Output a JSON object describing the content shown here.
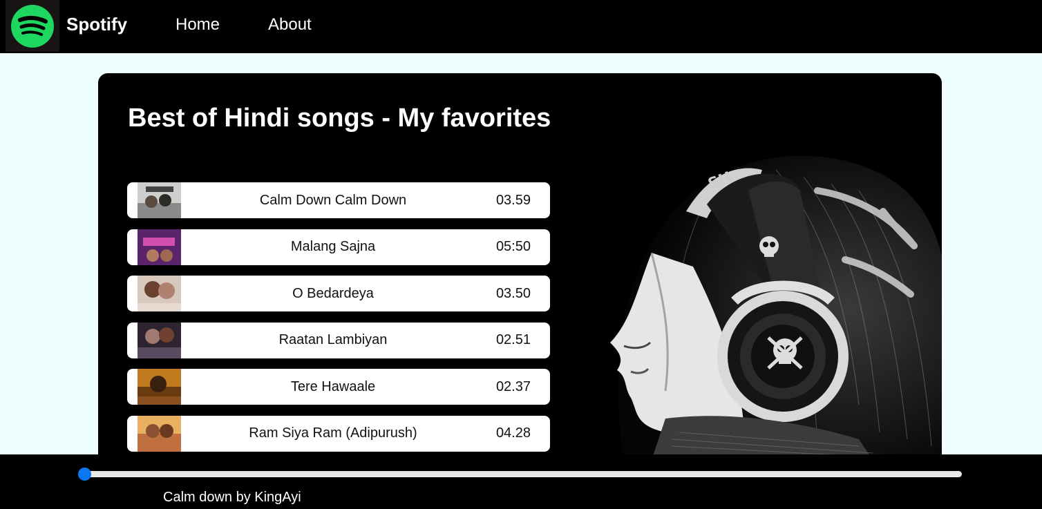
{
  "nav": {
    "brand": "Spotify",
    "links": [
      {
        "label": "Home"
      },
      {
        "label": "About"
      }
    ]
  },
  "playlist": {
    "title": "Best of Hindi songs - My favorites",
    "songs": [
      {
        "name": "Calm Down Calm Down",
        "duration": "03.59"
      },
      {
        "name": "Malang Sajna",
        "duration": "05:50"
      },
      {
        "name": "O Bedardeya",
        "duration": "03.50"
      },
      {
        "name": "Raatan Lambiyan",
        "duration": "02.51"
      },
      {
        "name": "Tere Hawaale",
        "duration": "02.37"
      },
      {
        "name": "Ram Siya Ram (Adipurush)",
        "duration": "04.28"
      }
    ]
  },
  "player": {
    "now_playing": "Calm down by KingAyi",
    "progress": 0
  },
  "colors": {
    "accent": "#1ed760",
    "slider": "#0b78f2",
    "page_bg": "#effffe"
  }
}
